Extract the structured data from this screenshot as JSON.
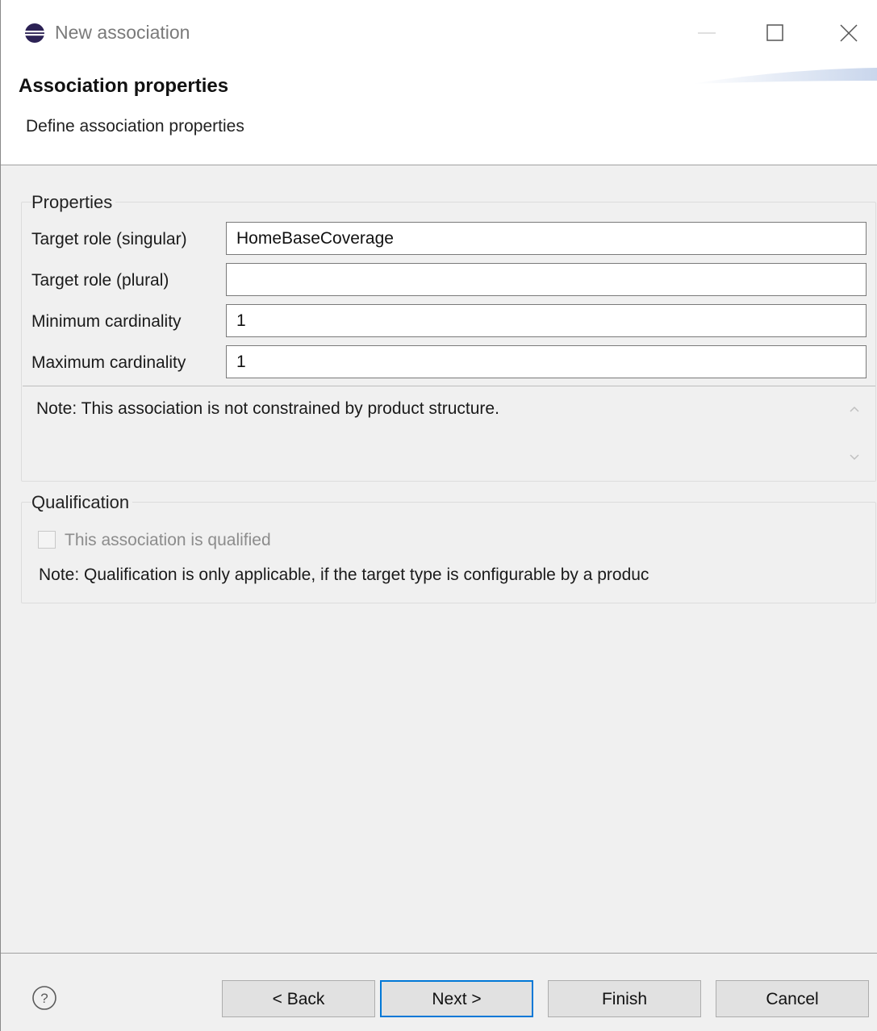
{
  "window": {
    "title": "New association",
    "icon": "eclipse-icon"
  },
  "banner": {
    "title": "Association properties",
    "description": "Define association properties"
  },
  "properties": {
    "legend": "Properties",
    "fields": [
      {
        "label": "Target role (singular)",
        "value": "HomeBaseCoverage"
      },
      {
        "label": "Target role (plural)",
        "value": ""
      },
      {
        "label": "Minimum cardinality",
        "value": "1"
      },
      {
        "label": "Maximum cardinality",
        "value": "1"
      }
    ],
    "note": "Note: This association is not constrained by product structure."
  },
  "qualification": {
    "legend": "Qualification",
    "checkbox_label": "This association is qualified",
    "checkbox_checked": false,
    "checkbox_enabled": false,
    "note": "Note: Qualification is only applicable, if the target type is configurable by a produc"
  },
  "footer": {
    "help_icon": "help-icon",
    "back_label": "< Back",
    "next_label": "Next >",
    "finish_label": "Finish",
    "cancel_label": "Cancel"
  },
  "colors": {
    "accent": "#0078d7",
    "background": "#f0f0f0"
  }
}
